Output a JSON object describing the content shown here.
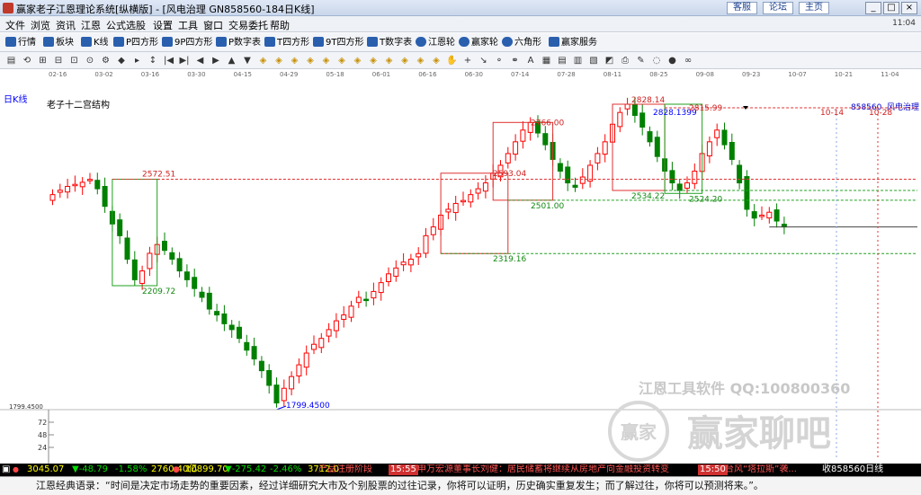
{
  "window": {
    "title": "赢家老子江恩理论系统[纵横版] - [风电治理  GN858560-184日K线]",
    "links": [
      "客服",
      "论坛",
      "主页"
    ],
    "win_buttons": [
      "_",
      "□",
      "×"
    ]
  },
  "menu": {
    "items": [
      "文件",
      "浏览",
      "资讯",
      "江恩",
      "公式选股",
      "设置",
      "工具",
      "窗口",
      "交易委托",
      "帮助"
    ],
    "time": "11:04"
  },
  "toolbar": {
    "items": [
      "行情",
      "板块",
      "K线",
      "P四方形",
      "9P四方形",
      "P数字表",
      "T四方形",
      "9T四方形",
      "T数字表",
      "江恩轮",
      "赢家轮",
      "六角形",
      "赢家服务"
    ]
  },
  "drawbar": {
    "tools": [
      "▤",
      "⟲",
      "⊞",
      "⊟",
      "⊡",
      "⊙",
      "⚙",
      "◆",
      "▸",
      "↕",
      "|◀",
      "▶|",
      "◀",
      "▶",
      "▲",
      "▼",
      "◈",
      "◈",
      "◈",
      "◈",
      "◈",
      "◈",
      "◈",
      "◈",
      "◈",
      "◈",
      "◈",
      "◈",
      "✋",
      "+",
      "↘",
      "⚬",
      "⚭",
      "A",
      "▦",
      "▤",
      "▥",
      "▧",
      "◩",
      "⎙",
      "✎",
      "◌",
      "●",
      "∞"
    ]
  },
  "chart_header": {
    "period": "日K线",
    "structure": "老子十二宫结构",
    "code": "858560",
    "name": "风电治理"
  },
  "chart_data": {
    "type": "candlestick",
    "date_ticks": [
      "02-16",
      "03-02",
      "03-16",
      "03-30",
      "04-15",
      "04-29",
      "05-18",
      "06-01",
      "06-16",
      "06-30",
      "07-14",
      "07-28",
      "08-11",
      "08-25",
      "09-08",
      "09-23",
      "10-07",
      "10-21",
      "11-04"
    ],
    "price_labels": [
      {
        "text": "2572.51",
        "value": 2572.51
      },
      {
        "text": "2209.72",
        "value": 2209.72
      },
      {
        "text": "1799.4500",
        "value": 1799.45
      },
      {
        "text": "2319.16",
        "value": 2319.16
      },
      {
        "text": "2593.04",
        "value": 2593.04
      },
      {
        "text": "2501.00",
        "value": 2501.0
      },
      {
        "text": "2766.00",
        "value": 2766.0
      },
      {
        "text": "2828.14",
        "value": 2828.14
      },
      {
        "text": "2828.1399",
        "value": 2828.14
      },
      {
        "text": "2815.99",
        "value": 2815.99
      },
      {
        "text": "2534.22",
        "value": 2534.22
      },
      {
        "text": "2524.20",
        "value": 2524.2
      }
    ],
    "left_axis": {
      "price": "1799.4500",
      "volume_ticks": [
        "72",
        "48",
        "24"
      ]
    },
    "future_markers": [
      "10-14",
      "10-28"
    ],
    "closes": [
      2520,
      2535,
      2548,
      2555,
      2562,
      2572,
      2540,
      2480,
      2420,
      2380,
      2300,
      2230,
      2260,
      2320,
      2350,
      2330,
      2300,
      2260,
      2230,
      2200,
      2170,
      2130,
      2110,
      2080,
      2060,
      2030,
      1990,
      1960,
      1920,
      1870,
      1810,
      1860,
      1900,
      1940,
      1980,
      2010,
      2030,
      2060,
      2090,
      2110,
      2140,
      2170,
      2160,
      2190,
      2220,
      2250,
      2270,
      2290,
      2300,
      2319,
      2380,
      2410,
      2450,
      2470,
      2490,
      2500,
      2520,
      2540,
      2560,
      2593,
      2620,
      2660,
      2700,
      2740,
      2766,
      2730,
      2690,
      2640,
      2600,
      2560,
      2545,
      2580,
      2620,
      2660,
      2700,
      2760,
      2800,
      2828,
      2790,
      2750,
      2700,
      2650,
      2600,
      2560,
      2534,
      2560,
      2600,
      2660,
      2700,
      2740,
      2690,
      2640,
      2560,
      2470,
      2440,
      2450,
      2460,
      2430,
      2410
    ]
  },
  "watermark": {
    "software": "江恩工具软件  QQ:100800360",
    "brand": "赢家聊吧",
    "stamp": "赢家"
  },
  "status_bar": {
    "sh_index": "3045.07",
    "sh_change": "▼-48.79",
    "sh_pct": "-1.58%",
    "sh_amount": "2760.40亿",
    "sz_index": "10899.70",
    "sz_change": "▼-275.42",
    "sz_pct": "-2.46%",
    "sz_amount": "3712.0",
    "ticker1": "产品注册阶段",
    "ticker_time1": "15:55",
    "ticker2": "申万宏源董事长刘健：居民储蓄将继续从房地产向金融投资转变",
    "ticker_time2": "15:50",
    "ticker3": "台风“塔拉斯”袭...",
    "right": "收858560日线"
  },
  "quote": "江恩经典语录：“时间是决定市场走势的重要因素，经过详细研究大市及个别股票的过往记录，你将可以证明，历史确实重复发生；而了解过往，你将可以预测将来。”。",
  "colors": {
    "up": "#ff0000",
    "down": "#008000",
    "box_red": "#e03030",
    "box_green": "#20a020",
    "label_blue": "#0000ff",
    "label_red": "#d02020",
    "label_green": "#118811"
  }
}
